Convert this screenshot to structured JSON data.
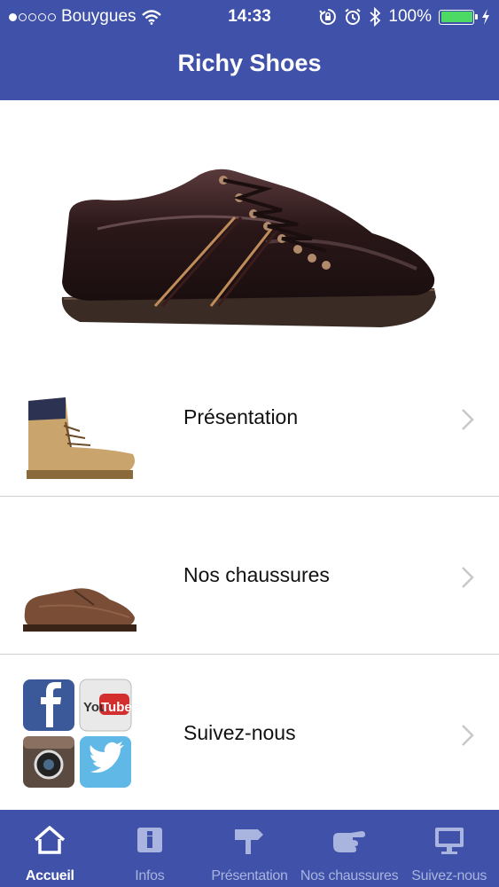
{
  "status": {
    "carrier": "Bouygues",
    "time": "14:33",
    "battery": "100%"
  },
  "header": {
    "title": "Richy Shoes"
  },
  "hero": {
    "icon": "dress-shoe-image"
  },
  "menu": [
    {
      "label": "Présentation",
      "icon": "boot-image"
    },
    {
      "label": "Nos chaussures",
      "icon": "shoe-image"
    },
    {
      "label": "Suivez-nous",
      "icon": "social-icons-image"
    }
  ],
  "tabs": [
    {
      "label": "Accueil",
      "icon": "home-icon"
    },
    {
      "label": "Infos",
      "icon": "info-icon"
    },
    {
      "label": "Présentation",
      "icon": "signpost-icon"
    },
    {
      "label": "Nos chaussures",
      "icon": "pointing-hand-icon"
    },
    {
      "label": "Suivez-nous",
      "icon": "monitor-icon"
    }
  ],
  "colors": {
    "brand": "#3f51a8",
    "tab_inactive": "#a9b4df",
    "battery": "#4cd964"
  }
}
